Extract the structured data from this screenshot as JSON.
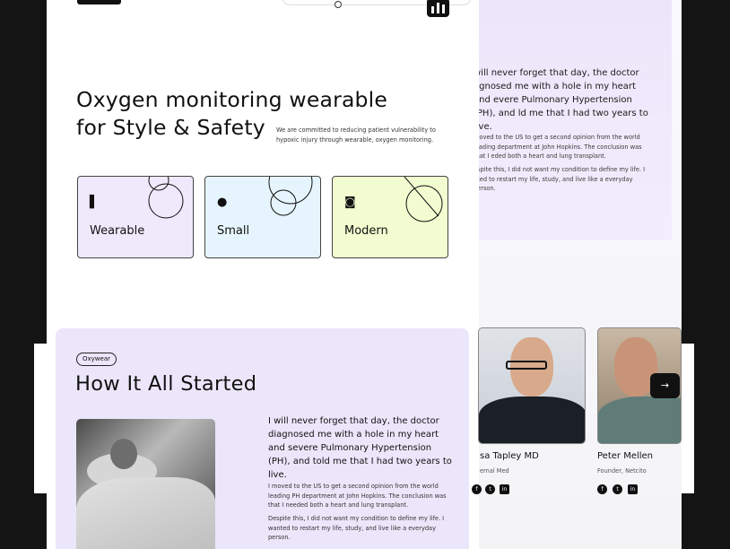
{
  "hero": {
    "title": "Oxygen monitoring wearable\nfor Style & Safety",
    "subtitle": "We are committed to reducing patient vulnerability to hypoxic injury through wearable, oxygen monitoring."
  },
  "features": [
    {
      "label": "Wearable",
      "icon": "wearable-icon",
      "bg": "#efe9fc"
    },
    {
      "label": "Small",
      "icon": "small-icon",
      "bg": "#e6f5fd"
    },
    {
      "label": "Modern",
      "icon": "modern-icon",
      "bg": "#f1fcd0"
    }
  ],
  "story": {
    "tag": "Oxywear",
    "title": "How It All Started",
    "quote": "I will never forget that day, the doctor diagnosed me with a hole in my heart and severe Pulmonary Hypertension (PH), and told me that I had two years to live.",
    "paragraph1": "I moved to the US to get a second opinion from the world leading PH department at John Hopkins. The conclusion was that I needed both a heart and lung transplant.",
    "paragraph2": "Despite this, I did not want my condition to define my life. I wanted to restart my life, study, and live like a everyday person."
  },
  "right_panel": {
    "quote": "will never forget that day, the doctor agnosed me with a hole in my heart and evere Pulmonary Hypertension (PH), and ld me that I had two years to live.",
    "paragraph1": "moved to the US to get a second opinion from the world leading department at John Hopkins. The conclusion was that I eded both a heart and lung transplant.",
    "paragraph2": "espite this, I did not want my condition to define my life. I nted to restart my life, study, and live like a everyday person."
  },
  "team": [
    {
      "name": "sa Tapley MD",
      "role": "ernal Med"
    },
    {
      "name": "Peter Mellen",
      "role": "Founder, Netcito"
    }
  ],
  "social_icons": [
    "facebook-icon",
    "twitter-icon",
    "linkedin-icon"
  ],
  "next_arrow": "→"
}
